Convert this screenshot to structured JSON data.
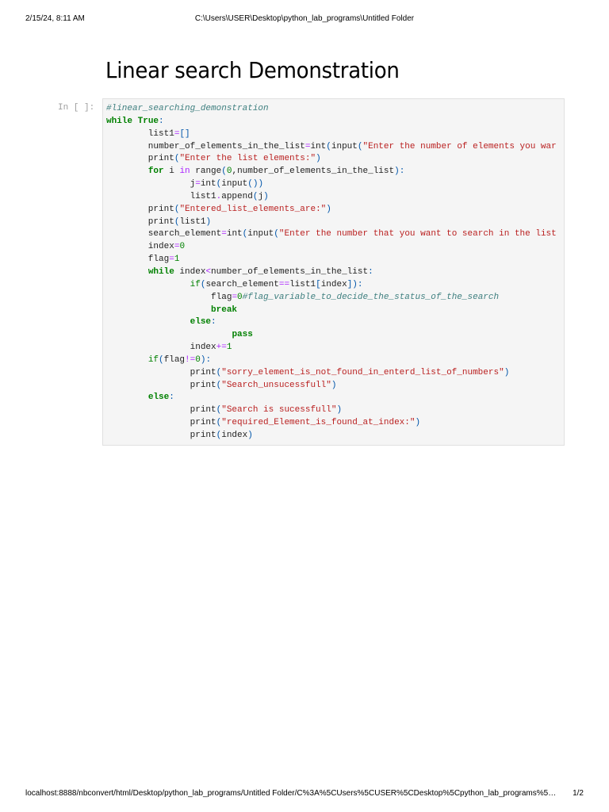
{
  "print_header": {
    "date": "2/15/24, 8:11 AM",
    "title": "C:\\Users\\USER\\Desktop\\python_lab_programs\\Untitled Folder"
  },
  "print_footer": {
    "url": "localhost:8888/nbconvert/html/Desktop/python_lab_programs/Untitled Folder/C%3A%5CUsers%5CUSER%5CDesktop%5Cpython_lab_programs%5…",
    "page": "1/2"
  },
  "heading": "Linear search Demonstration",
  "cell": {
    "prompt": "In [ ]:",
    "lines": [
      [
        [
          "#linear_searching_demonstration",
          "c"
        ]
      ],
      [
        [
          "while",
          "k"
        ],
        [
          " ",
          "n"
        ],
        [
          "True",
          "k"
        ],
        [
          ":",
          "p"
        ]
      ],
      [
        [
          "        list1",
          "n"
        ],
        [
          "=",
          "o"
        ],
        [
          "[]",
          "p"
        ]
      ],
      [
        [
          "        number_of_elements_in_the_list",
          "n"
        ],
        [
          "=",
          "o"
        ],
        [
          "int",
          "n"
        ],
        [
          "(",
          "p"
        ],
        [
          "input",
          "n"
        ],
        [
          "(",
          "p"
        ],
        [
          "\"Enter the number of elements you war",
          "s"
        ]
      ],
      [
        [
          "        print",
          "n"
        ],
        [
          "(",
          "p"
        ],
        [
          "\"Enter the list elements:\"",
          "s"
        ],
        [
          ")",
          "p"
        ]
      ],
      [
        [
          "        ",
          "n"
        ],
        [
          "for",
          "k"
        ],
        [
          " i ",
          "n"
        ],
        [
          "in",
          "o"
        ],
        [
          " range",
          "n"
        ],
        [
          "(",
          "p"
        ],
        [
          "0",
          "m"
        ],
        [
          ",number_of_elements_in_the_list",
          "n"
        ],
        [
          "):",
          "p"
        ]
      ],
      [
        [
          "                j",
          "n"
        ],
        [
          "=",
          "o"
        ],
        [
          "int",
          "n"
        ],
        [
          "(",
          "p"
        ],
        [
          "input",
          "n"
        ],
        [
          "())",
          "p"
        ]
      ],
      [
        [
          "                list1",
          "n"
        ],
        [
          ".",
          "o"
        ],
        [
          "append",
          "n"
        ],
        [
          "(",
          "p"
        ],
        [
          "j",
          "n"
        ],
        [
          ")",
          "p"
        ]
      ],
      [
        [
          "        print",
          "n"
        ],
        [
          "(",
          "p"
        ],
        [
          "\"Entered_list_elements_are:\"",
          "s"
        ],
        [
          ")",
          "p"
        ]
      ],
      [
        [
          "        print",
          "n"
        ],
        [
          "(",
          "p"
        ],
        [
          "list1",
          "n"
        ],
        [
          ")",
          "p"
        ]
      ],
      [
        [
          "        search_element",
          "n"
        ],
        [
          "=",
          "o"
        ],
        [
          "int",
          "n"
        ],
        [
          "(",
          "p"
        ],
        [
          "input",
          "n"
        ],
        [
          "(",
          "p"
        ],
        [
          "\"Enter the number that you want to search in the list",
          "s"
        ]
      ],
      [
        [
          "        index",
          "n"
        ],
        [
          "=",
          "o"
        ],
        [
          "0",
          "m"
        ]
      ],
      [
        [
          "        flag",
          "n"
        ],
        [
          "=",
          "o"
        ],
        [
          "1",
          "m"
        ]
      ],
      [
        [
          "        ",
          "n"
        ],
        [
          "while",
          "k"
        ],
        [
          " index",
          "n"
        ],
        [
          "<",
          "o"
        ],
        [
          "number_of_elements_in_the_list",
          "n"
        ],
        [
          ":",
          "p"
        ]
      ],
      [
        [
          "                ",
          "n"
        ],
        [
          "if",
          "b"
        ],
        [
          "(",
          "p"
        ],
        [
          "search_element",
          "n"
        ],
        [
          "==",
          "o"
        ],
        [
          "list1",
          "n"
        ],
        [
          "[",
          "p"
        ],
        [
          "index",
          "n"
        ],
        [
          "]):",
          "p"
        ]
      ],
      [
        [
          "                    flag",
          "n"
        ],
        [
          "=",
          "o"
        ],
        [
          "0",
          "m"
        ],
        [
          "#flag_variable_to_decide_the_status_of_the_search",
          "c"
        ]
      ],
      [
        [
          "                    ",
          "n"
        ],
        [
          "break",
          "k"
        ]
      ],
      [
        [
          "                ",
          "n"
        ],
        [
          "else",
          "k"
        ],
        [
          ":",
          "p"
        ]
      ],
      [
        [
          "                        ",
          "n"
        ],
        [
          "pass",
          "k"
        ]
      ],
      [
        [
          "                index",
          "n"
        ],
        [
          "+=",
          "o"
        ],
        [
          "1",
          "m"
        ]
      ],
      [
        [
          "        ",
          "n"
        ],
        [
          "if",
          "b"
        ],
        [
          "(",
          "p"
        ],
        [
          "flag",
          "n"
        ],
        [
          "!=",
          "o"
        ],
        [
          "0",
          "m"
        ],
        [
          "):",
          "p"
        ]
      ],
      [
        [
          "                print",
          "n"
        ],
        [
          "(",
          "p"
        ],
        [
          "\"sorry_element_is_not_found_in_enterd_list_of_numbers\"",
          "s"
        ],
        [
          ")",
          "p"
        ]
      ],
      [
        [
          "                print",
          "n"
        ],
        [
          "(",
          "p"
        ],
        [
          "\"Search_unsucessfull\"",
          "s"
        ],
        [
          ")",
          "p"
        ]
      ],
      [
        [
          "        ",
          "n"
        ],
        [
          "else",
          "k"
        ],
        [
          ":",
          "p"
        ]
      ],
      [
        [
          "                print",
          "n"
        ],
        [
          "(",
          "p"
        ],
        [
          "\"Search is sucessfull\"",
          "s"
        ],
        [
          ")",
          "p"
        ]
      ],
      [
        [
          "                print",
          "n"
        ],
        [
          "(",
          "p"
        ],
        [
          "\"required_Element_is_found_at_index:\"",
          "s"
        ],
        [
          ")",
          "p"
        ]
      ],
      [
        [
          "                print",
          "n"
        ],
        [
          "(",
          "p"
        ],
        [
          "index",
          "n"
        ],
        [
          ")",
          "p"
        ]
      ]
    ]
  }
}
